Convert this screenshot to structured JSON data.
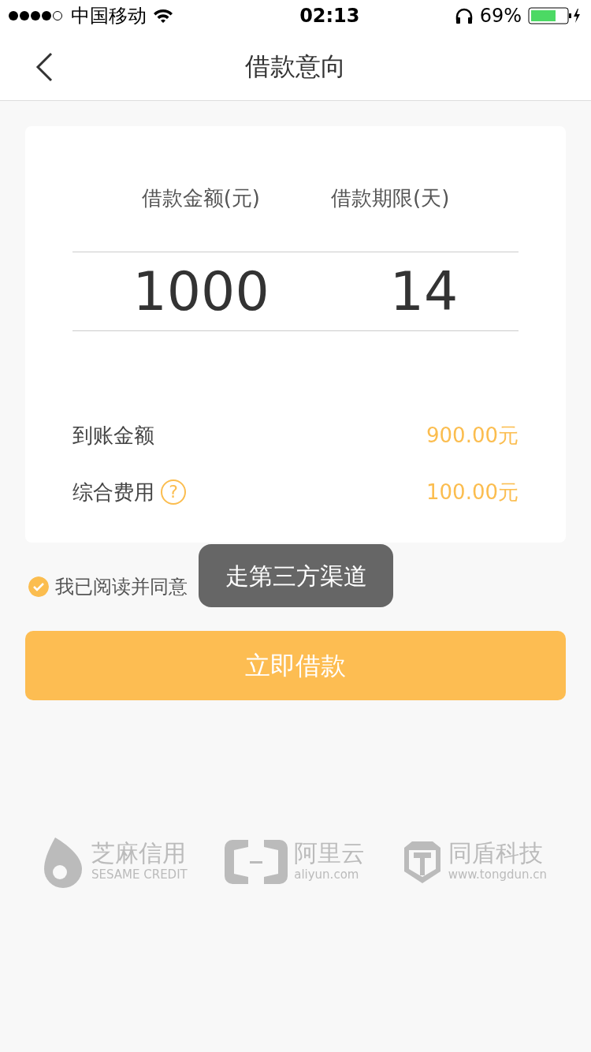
{
  "status_bar": {
    "carrier": "中国移动",
    "time": "02:13",
    "battery": "69%"
  },
  "nav": {
    "title": "借款意向"
  },
  "picker": {
    "columns": [
      {
        "label": "借款金额(元)",
        "value": "1000"
      },
      {
        "label": "借款期限(天)",
        "value": "14"
      }
    ]
  },
  "summary": [
    {
      "label": "到账金额",
      "value": "900.00元"
    },
    {
      "label": "综合费用",
      "value": "100.00元",
      "help": "?"
    }
  ],
  "agreement": {
    "checked": true,
    "text": "我已阅读并同意"
  },
  "submit": "立即借款",
  "toast": "走第三方渠道",
  "partners": [
    {
      "kind": "sesame",
      "name": "芝麻信用",
      "sub": "SESAME CREDIT"
    },
    {
      "kind": "aliyun",
      "name": "阿里云",
      "sub": "aliyun.com"
    },
    {
      "kind": "tongdun",
      "name": "同盾科技",
      "sub": "www.tongdun.cn"
    }
  ]
}
